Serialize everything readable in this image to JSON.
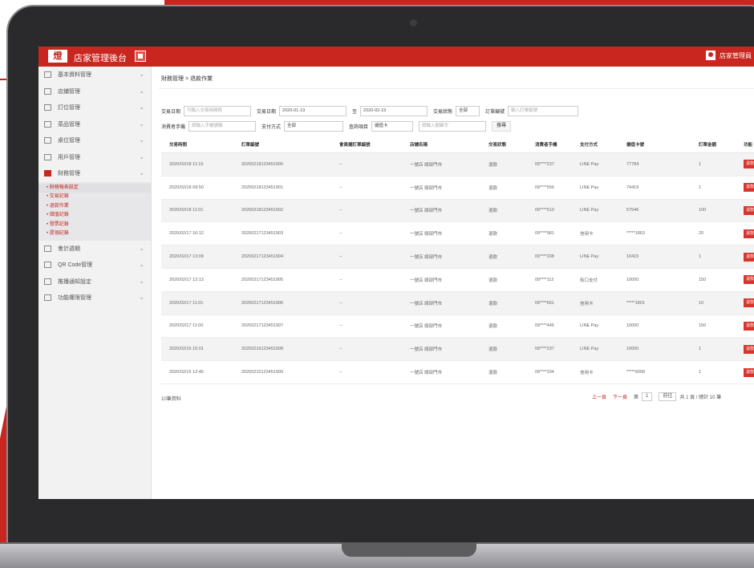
{
  "app": {
    "logo": "燈",
    "title": "店家管理後台",
    "user": "店家管理員"
  },
  "sidebar": {
    "items": [
      {
        "label": "基本資料管理",
        "active": false
      },
      {
        "label": "店鋪管理",
        "active": false
      },
      {
        "label": "訂位管理",
        "active": false
      },
      {
        "label": "菜品管理",
        "active": false
      },
      {
        "label": "桌位管理",
        "active": false
      },
      {
        "label": "用戶管理",
        "active": false
      },
      {
        "label": "財務管理",
        "active": true
      }
    ],
    "submenu": [
      "財務報表設定",
      "交易記錄",
      "退款作業",
      "儲值記錄",
      "發票記錄",
      "提領記錄"
    ],
    "items_after": [
      {
        "label": "會計週期"
      },
      {
        "label": "QR Code管理"
      },
      {
        "label": "推播通知設定"
      },
      {
        "label": "功能權限管理"
      }
    ]
  },
  "breadcrumb": "財務管理 > 退款作業",
  "filters": {
    "order_date_label": "交易日期",
    "order_date_placeholder": "可輸入交易時間段",
    "date_from_label": "交易日期",
    "date_from": "2020-01-19",
    "date_to_label": "至",
    "date_to": "2020-02-19",
    "status_label": "交易狀態",
    "status_value": "全部",
    "order_no_label": "訂單編號",
    "order_no_placeholder": "輸入訂單編號",
    "member_label": "消費者手機",
    "member_placeholder": "請輸入手機號碼",
    "pay_label": "支付方式",
    "pay_value": "全部",
    "type_label": "查詢項目",
    "type_value": "儲值卡",
    "keyword_placeholder": "請輸入關鍵字",
    "search_label": "搜尋"
  },
  "table": {
    "headers": [
      "交易時間",
      "訂單編號",
      "會員儲訂單編號",
      "店舖名稱",
      "交易狀態",
      "消費者手機",
      "支付方式",
      "儲值卡號",
      "訂單金額",
      "功能"
    ],
    "rows": [
      [
        "2020/02/18 11:15",
        "20200218123451900",
        "--",
        "一號店 總部門市",
        "退款",
        "09****237",
        "LINE Pay",
        "77784",
        "1",
        "退款"
      ],
      [
        "2020/02/18 09:50",
        "20200218123451901",
        "--",
        "一號店 總部門市",
        "退款",
        "09****556",
        "LINE Pay",
        "74419",
        "1",
        "退款"
      ],
      [
        "2020/02/18 11:01",
        "20200218123451902",
        "--",
        "一號店 總部門市",
        "退款",
        "09****510",
        "LINE Pay",
        "57546",
        "100",
        "退款"
      ],
      [
        "2020/02/17 16:12",
        "20200217123451903",
        "--",
        "一號店 總部門市",
        "退款",
        "09****981",
        "信用卡",
        "*****1863",
        "20",
        "退款"
      ],
      [
        "2020/02/17 13:09",
        "20200217123451904",
        "--",
        "一號店 總部門市",
        "退款",
        "09****208",
        "LINE Pay",
        "10415",
        "1",
        "退款"
      ],
      [
        "2020/02/17 12:13",
        "20200217123451905",
        "--",
        "一號店 總部門市",
        "退款",
        "09****112",
        "街口支付",
        "10000",
        "150",
        "退款"
      ],
      [
        "2020/02/17 11:01",
        "20200217123451906",
        "--",
        "一號店 總部門市",
        "退款",
        "09****561",
        "信用卡",
        "*****1801",
        "10",
        "退款"
      ],
      [
        "2020/02/17 11:00",
        "20200217123451907",
        "--",
        "一號店 總部門市",
        "退款",
        "09****445",
        "LINE Pay",
        "10000",
        "150",
        "退款"
      ],
      [
        "2020/02/16 15:01",
        "20200216123451908",
        "--",
        "一號店 總部門市",
        "退款",
        "09****237",
        "LINE Pay",
        "10000",
        "1",
        "退款"
      ],
      [
        "2020/02/15 12:45",
        "20200215123451909",
        "--",
        "一號店 總部門市",
        "退款",
        "09****334",
        "信用卡",
        "*****9008",
        "1",
        "退款"
      ]
    ]
  },
  "footer": {
    "total": "10筆資料",
    "prev": "上一頁",
    "next": "下一頁",
    "page_label": "第",
    "page_value": "1",
    "go": "前往",
    "summary": "共 1 頁 / 總計 10 筆"
  },
  "colors": {
    "brand_red": "#c8261f",
    "laptop_frame": "#2a2a2c"
  }
}
